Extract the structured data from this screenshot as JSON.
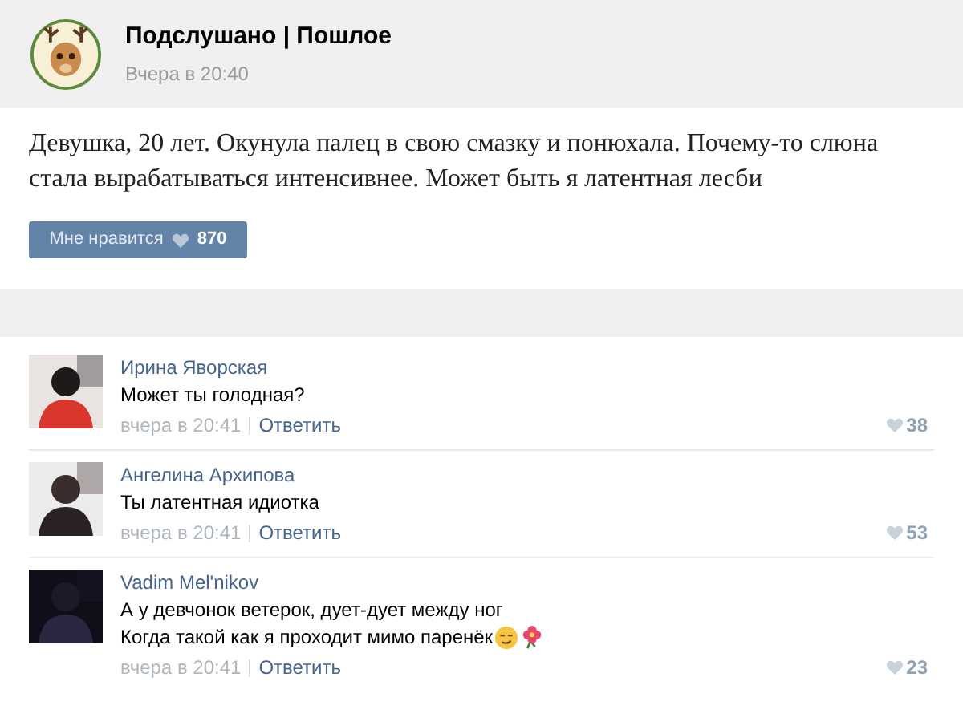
{
  "post": {
    "author": "Подслушано | Пошлое",
    "time": "Вчера в 20:40",
    "text": "Девушка, 20 лет. Окунула палец в свою смазку и понюхала. Почему-то слюна стала вырабатываться интенсивнее. Может быть я латентная лесби",
    "like_label": "Мне нравится",
    "like_count": "870"
  },
  "comments": [
    {
      "author": "Ирина Яворская",
      "avatar": {
        "kind": "picture"
      },
      "lines": [
        {
          "text": "Может ты голодная?"
        }
      ],
      "time": "вчера в 20:41",
      "reply": "Ответить",
      "likes": "38"
    },
    {
      "author": "Ангелина Архипова",
      "avatar": {
        "kind": "picture"
      },
      "lines": [
        {
          "text": "Ты латентная идиотка"
        }
      ],
      "time": "вчера в 20:41",
      "reply": "Ответить",
      "likes": "53"
    },
    {
      "author": "Vadim Mel'nikov",
      "avatar": {
        "kind": "picture"
      },
      "lines": [
        {
          "text": "А у девчонок ветерок, дует-дует между ног"
        },
        {
          "text": "Когда такой как я проходит мимо паренёк",
          "emojis": [
            {
              "kind": "smirk"
            },
            {
              "kind": "flower"
            }
          ]
        }
      ],
      "time": "вчера в 20:41",
      "reply": "Ответить",
      "likes": "23"
    }
  ]
}
